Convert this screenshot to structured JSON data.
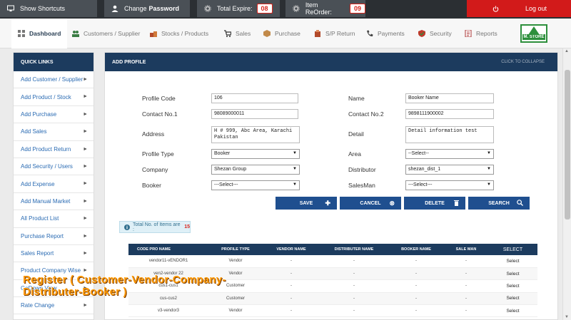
{
  "topbar": {
    "show_shortcuts": "Show Shortcuts",
    "change_password_a": "Change",
    "change_password_b": "Password",
    "total_expire_label": "Total Expire:",
    "total_expire_count": "08",
    "reorder_label": "Item ReOrder:",
    "reorder_count": "09",
    "logout": "Log out"
  },
  "nav": {
    "items": [
      "Dashboard",
      "Customers / Supplier",
      "Stocks / Products",
      "Sales",
      "Purchase",
      "S/P Return",
      "Payments",
      "Security",
      "Reports"
    ],
    "logo_text": "M. STORE"
  },
  "sidebar": {
    "title": "QUICK LINKS",
    "items": [
      "Add Customer / Supplier",
      "Add Product / Stock",
      "Add Purchase",
      "Add Sales",
      "Add Product Return",
      "Add Security / Users",
      "Add Expense",
      "Add Manual Market",
      "All Product List",
      "Purchase Report",
      "Sales Report",
      "Product Company Wise",
      "GoDown View",
      "Rate Change"
    ]
  },
  "panel": {
    "title": "ADD PROFILE",
    "collapse": "CLICK TO COLLAPSE"
  },
  "form": {
    "profile_code_label": "Profile Code",
    "profile_code_value": "106",
    "name_label": "Name",
    "name_value": "Booker Name",
    "contact1_label": "Contact No.1",
    "contact1_value": "98089000011",
    "contact2_label": "Contact No.2",
    "contact2_value": "9898111900002",
    "address_label": "Address",
    "address_value": "H # 999, Abc Area, Karachi Pakistan",
    "detail_label": "Detail",
    "detail_value": "Detail information test",
    "profile_type_label": "Profile Type",
    "profile_type_value": "Booker",
    "area_label": "Area",
    "area_value": "--Select--",
    "company_label": "Company",
    "company_value": "Shezan Group",
    "distributor_label": "Distributor",
    "distributor_value": "shezan_dist_1",
    "booker_label": "Booker",
    "booker_value": "---Select---",
    "salesman_label": "SalesMan",
    "salesman_value": "---Select---"
  },
  "buttons": {
    "save": "SAVE",
    "cancel": "CANCEL",
    "delete": "DELETE",
    "search": "SEARCH"
  },
  "total": {
    "label": "Total No. of Items are :",
    "count": "15"
  },
  "table": {
    "headers": [
      "CODE PRO NAME",
      "PROFILE TYPE",
      "VENDOR NAME",
      "DISTRIBUTER NAME",
      "BOOKER NAME",
      "SALE MAN",
      "SELECT"
    ],
    "rows": [
      [
        "vendor11-vENDOR1",
        "Vendor",
        "-",
        "-",
        "-",
        "-",
        "Select"
      ],
      [
        "ven2-vendor 22",
        "Vendor",
        "-",
        "-",
        "-",
        "-",
        "Select"
      ],
      [
        "cus1-cus1",
        "Customer",
        "-",
        "-",
        "-",
        "-",
        "Select"
      ],
      [
        "cus-cus2",
        "Customer",
        "-",
        "-",
        "-",
        "-",
        "Select"
      ],
      [
        "v3-vendor3",
        "Vendor",
        "-",
        "-",
        "-",
        "-",
        "Select"
      ]
    ]
  },
  "overlay": {
    "line1": "Register ( Customer-Vendor-Company-",
    "line2": "Distributer-Booker )"
  },
  "colors": {
    "topbar": "#2b2f33",
    "accent_navy": "#1c3b5e",
    "button_blue": "#1f4f8f",
    "logout_red": "#d21a1a",
    "overlay_orange": "#ff9900"
  }
}
